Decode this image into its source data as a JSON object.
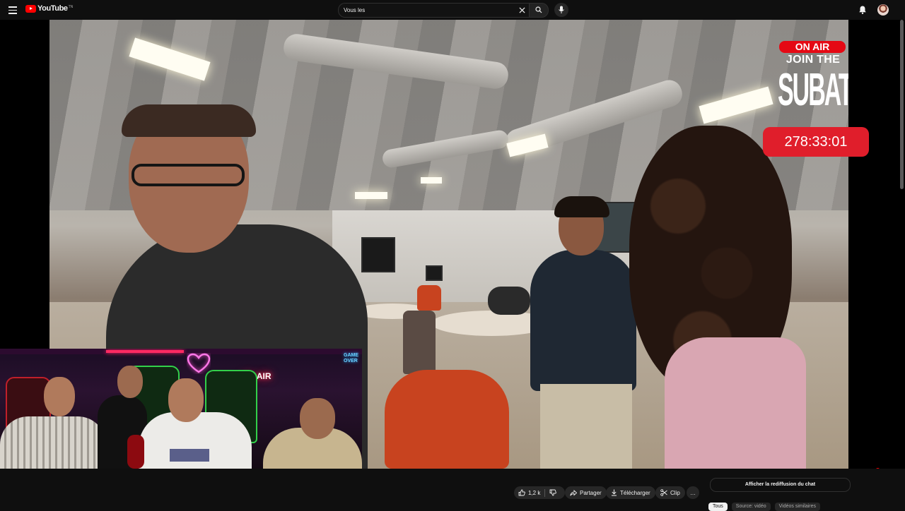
{
  "header": {
    "logo_text": "YouTube",
    "logo_tm": "TN",
    "search_value": "Vous les",
    "icons": [
      "menu-icon",
      "youtube-logo-icon",
      "clear-icon",
      "search-icon",
      "mic-icon",
      "bell-icon",
      "avatar"
    ]
  },
  "overlay": {
    "on_air": "ON AIR",
    "join_the": "JOIN THE",
    "subathon": "SUBATHON",
    "timer": "278:33:01"
  },
  "webcam": {
    "neon_sign": "ON AIR",
    "game_over_line1": "GAME",
    "game_over_line2": "OVER"
  },
  "player": {
    "progress_fraction": 0.96,
    "controls": [
      "autoplay-toggle-icon",
      "subtitles-icon",
      "settings-icon",
      "miniplayer-icon",
      "theater-icon",
      "cast-icon",
      "fullscreen-icon"
    ]
  },
  "actions": {
    "like_count": "1,2 k",
    "share_label": "Partager",
    "download_label": "Télécharger",
    "clip_label": "Clip",
    "more_label": "…"
  },
  "chat_button": "Afficher la rediffusion du chat",
  "chips": [
    "Tous",
    "Source: vidéo",
    "Vidéos similaires"
  ],
  "colors": {
    "accent": "#ff0000",
    "background": "#0f0f0f",
    "timer_bg": "#e01e2b"
  }
}
